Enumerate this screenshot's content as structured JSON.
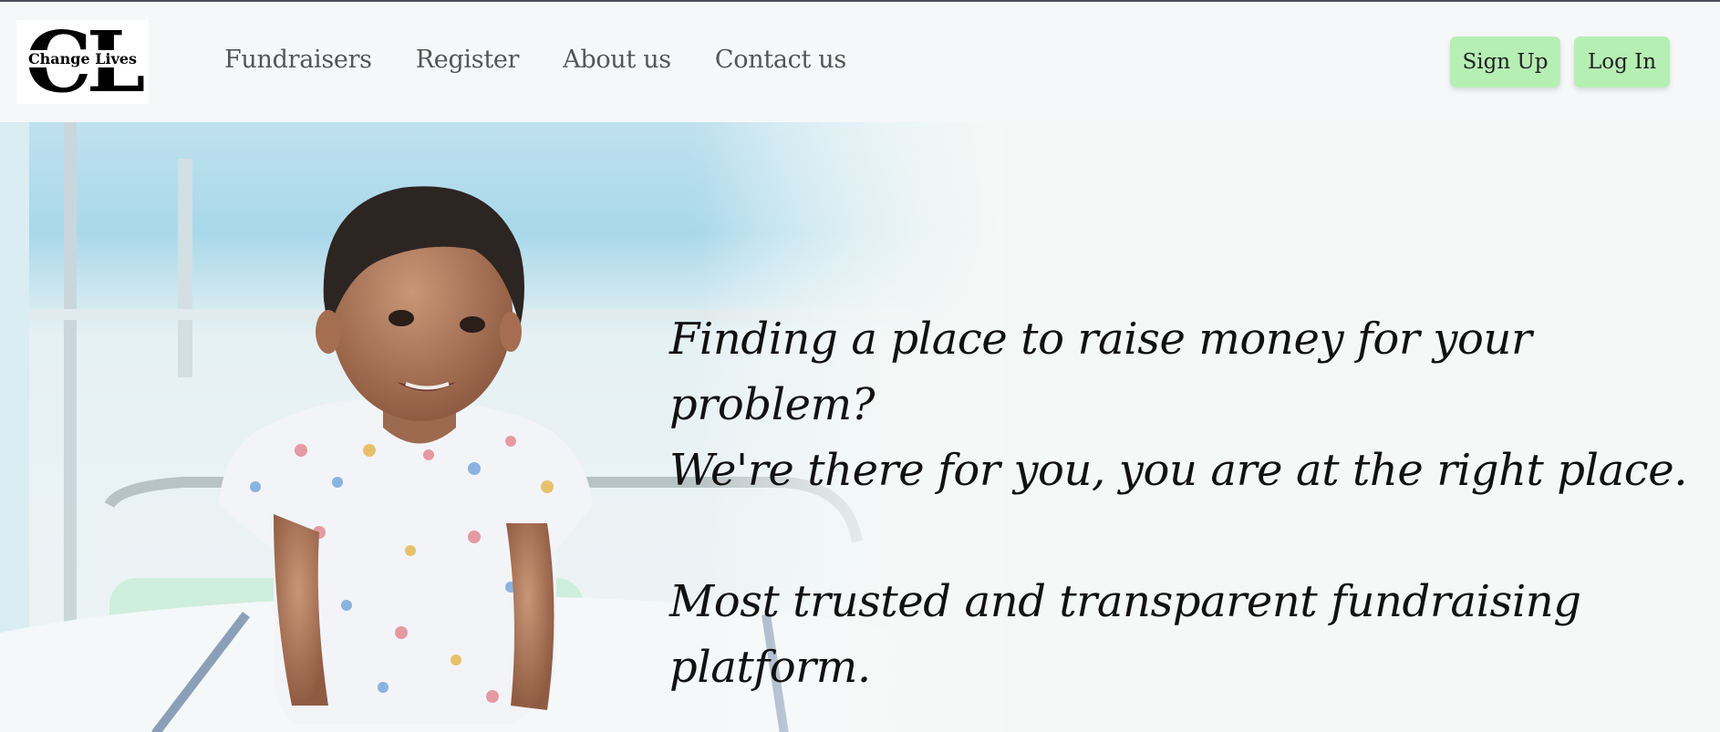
{
  "logo": {
    "monogram": "CL",
    "name": "Change Lives"
  },
  "nav": {
    "items": [
      {
        "label": "Fundraisers"
      },
      {
        "label": "Register"
      },
      {
        "label": "About us"
      },
      {
        "label": "Contact us"
      }
    ]
  },
  "auth": {
    "signup_label": "Sign Up",
    "login_label": "Log In"
  },
  "hero": {
    "line1": "Finding a place to raise money for your problem?",
    "line2": "We're there for you, you are at the right place.",
    "line3": "Most trusted and transparent fundraising",
    "line4": "platform."
  },
  "colors": {
    "button_bg": "#b6efb4",
    "nav_text": "#555555",
    "hero_text": "#111111"
  }
}
